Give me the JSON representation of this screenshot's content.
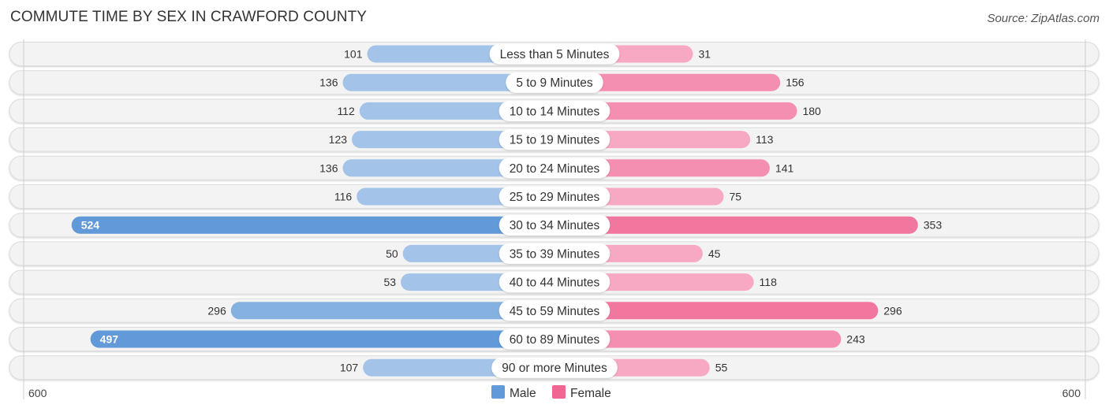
{
  "header": {
    "title": "COMMUTE TIME BY SEX IN CRAWFORD COUNTY",
    "source": "Source: ZipAtlas.com"
  },
  "colors": {
    "male_strong": "#6199d9",
    "male_light": "#a3c4e8",
    "female_strong": "#f06592",
    "female_light": "#f7a8c2",
    "track": "#f3f3f3"
  },
  "chart_data": {
    "type": "bar",
    "orientation": "horizontal-diverging",
    "title": "COMMUTE TIME BY SEX IN CRAWFORD COUNTY",
    "categories": [
      "Less than 5 Minutes",
      "5 to 9 Minutes",
      "10 to 14 Minutes",
      "15 to 19 Minutes",
      "20 to 24 Minutes",
      "25 to 29 Minutes",
      "30 to 34 Minutes",
      "35 to 39 Minutes",
      "40 to 44 Minutes",
      "45 to 59 Minutes",
      "60 to 89 Minutes",
      "90 or more Minutes"
    ],
    "series": [
      {
        "name": "Male",
        "side": "left",
        "values": [
          101,
          136,
          112,
          123,
          136,
          116,
          524,
          50,
          53,
          296,
          497,
          107
        ]
      },
      {
        "name": "Female",
        "side": "right",
        "values": [
          31,
          156,
          180,
          113,
          141,
          75,
          353,
          45,
          118,
          296,
          243,
          55
        ]
      }
    ],
    "xlim": [
      600,
      600
    ],
    "axis_ticks": {
      "left": "600",
      "right": "600"
    },
    "legend": {
      "position": "bottom-center",
      "entries": [
        "Male",
        "Female"
      ]
    },
    "grid": false
  }
}
